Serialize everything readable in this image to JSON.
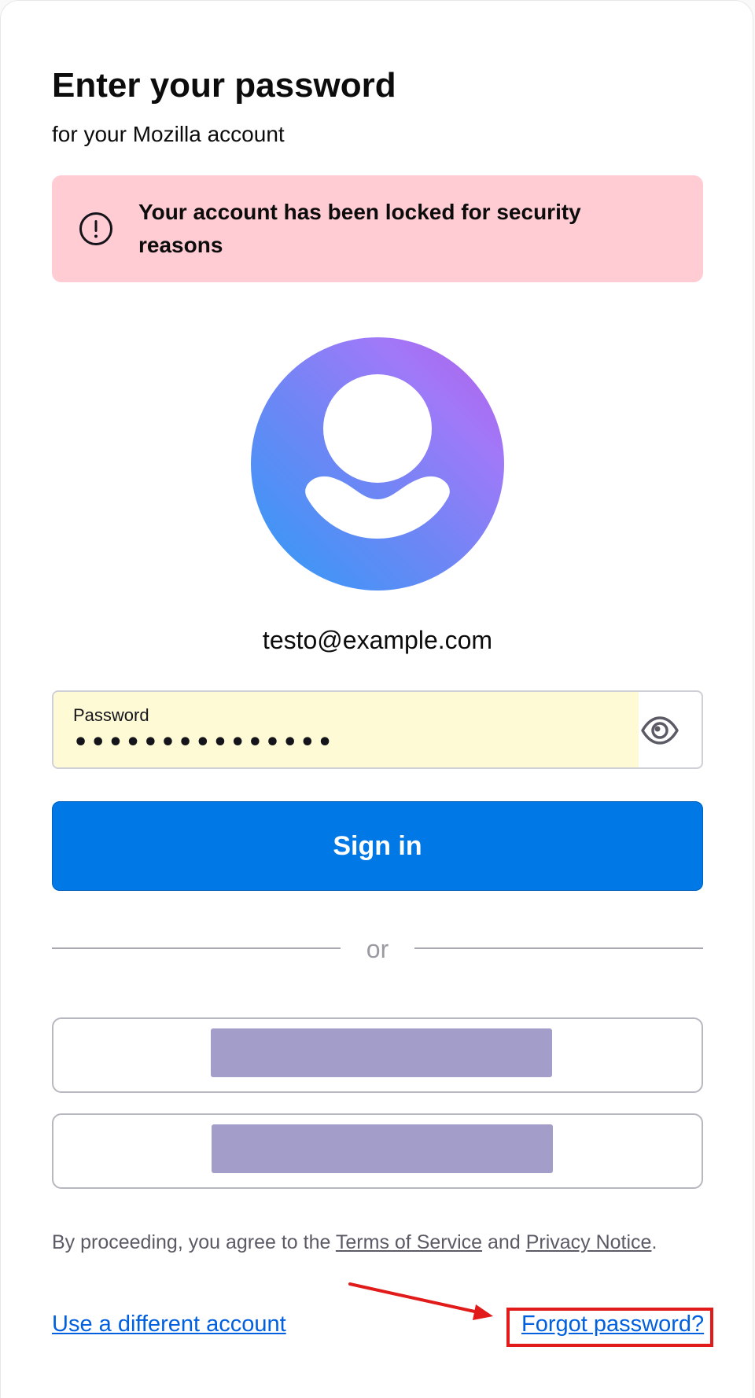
{
  "header": {
    "title": "Enter your password",
    "subtitle": "for your Mozilla account"
  },
  "alert": {
    "icon": "exclamation-circle-icon",
    "message": "Your account has been locked for security reasons",
    "background": "#ffccd3"
  },
  "account": {
    "avatar_icon": "default-avatar-icon",
    "email": "testo@example.com"
  },
  "password_field": {
    "label": "Password",
    "value": "•••••••••••••••",
    "toggle_icon": "eye-icon"
  },
  "actions": {
    "sign_in_label": "Sign in",
    "accent_color": "#0078e6",
    "divider_text": "or"
  },
  "legal": {
    "prefix": "By proceeding, you agree to the ",
    "terms_link": "Terms of Service",
    "conjunction": " and ",
    "privacy_link": "Privacy Notice",
    "suffix": "."
  },
  "footer": {
    "different_account_link": "Use a different account",
    "forgot_password_link": "Forgot password?"
  },
  "annotation": {
    "color": "#e11a1a"
  }
}
